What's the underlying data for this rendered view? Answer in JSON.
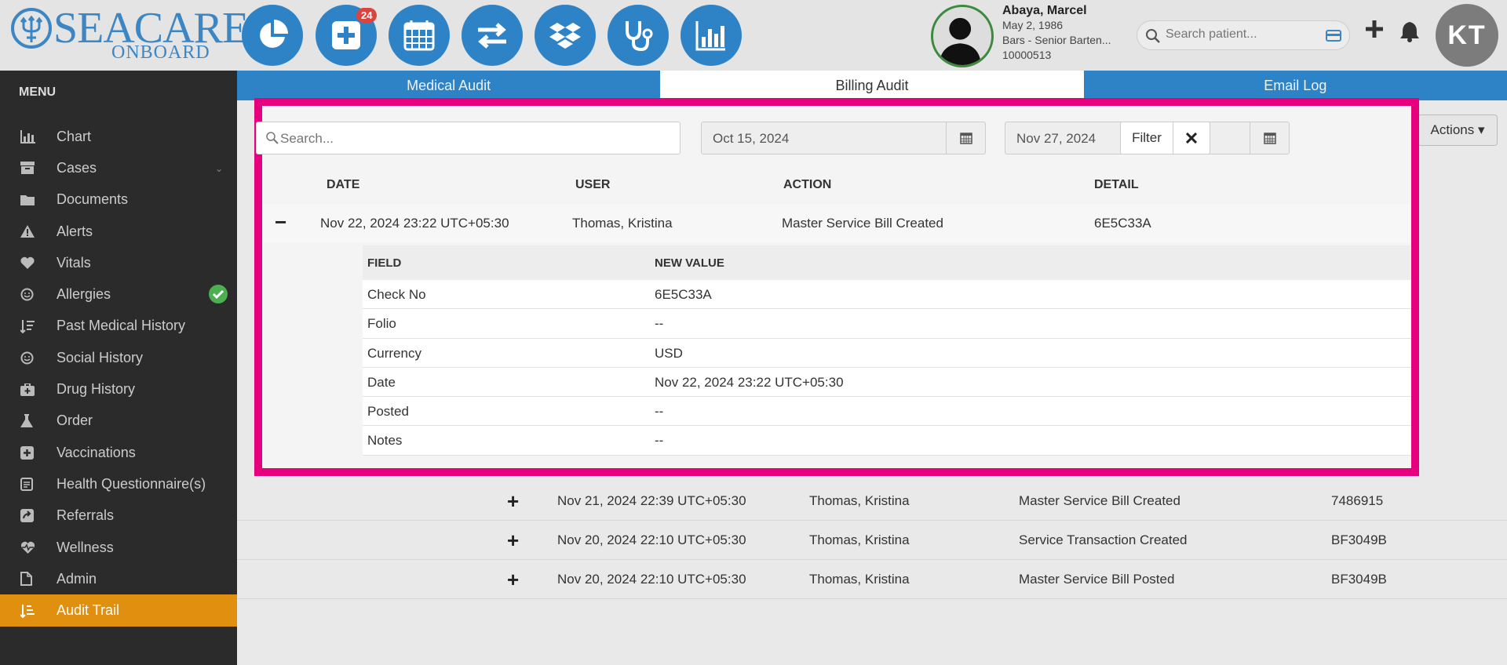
{
  "brand": {
    "name": "SEACARE",
    "sub": "ONBOARD"
  },
  "toolbar": {
    "buttons": [
      {
        "name": "dashboard-button",
        "icon": "pie-chart-icon"
      },
      {
        "name": "medical-cases-button",
        "icon": "medical-plus-icon",
        "badge": "24"
      },
      {
        "name": "calendar-button",
        "icon": "calendar-icon"
      },
      {
        "name": "transfer-button",
        "icon": "transfer-arrows-icon"
      },
      {
        "name": "dropbox-button",
        "icon": "dropbox-icon"
      },
      {
        "name": "stethoscope-button",
        "icon": "stethoscope-icon"
      },
      {
        "name": "reports-button",
        "icon": "bar-chart-icon"
      }
    ]
  },
  "patient": {
    "name": "Abaya, Marcel",
    "dob": "May 2, 1986",
    "role": "Bars - Senior Barten...",
    "id": "10000513"
  },
  "search": {
    "placeholder": "Search patient..."
  },
  "user": {
    "initials": "KT"
  },
  "sidebar": {
    "title": "MENU",
    "items": [
      {
        "label": "Chart",
        "icon": "bar-chart-icon"
      },
      {
        "label": "Cases",
        "icon": "archive-icon"
      },
      {
        "label": "Documents",
        "icon": "folder-icon"
      },
      {
        "label": "Alerts",
        "icon": "warning-icon"
      },
      {
        "label": "Vitals",
        "icon": "heart-icon"
      },
      {
        "label": "Allergies",
        "icon": "smile-icon"
      },
      {
        "label": "Past Medical History",
        "icon": "sort-icon"
      },
      {
        "label": "Social History",
        "icon": "smile-icon"
      },
      {
        "label": "Drug History",
        "icon": "medkit-icon"
      },
      {
        "label": "Order",
        "icon": "flask-icon"
      },
      {
        "label": "Vaccinations",
        "icon": "plus-square-icon"
      },
      {
        "label": "Health Questionnaire(s)",
        "icon": "questionnaire-icon"
      },
      {
        "label": "Referrals",
        "icon": "referral-icon"
      },
      {
        "label": "Wellness",
        "icon": "heartbeat-icon"
      },
      {
        "label": "Admin",
        "icon": "file-icon"
      },
      {
        "label": "Audit Trail",
        "icon": "audit-icon"
      }
    ],
    "active_color": "#e18f0f"
  },
  "tabs": [
    "Medical Audit",
    "Billing Audit",
    "Email Log"
  ],
  "actions_label": "Actions",
  "filter": {
    "search_placeholder": "Search...",
    "from_date": "Oct 15, 2024",
    "to_date": "Nov 27, 2024",
    "filter_label": "Filter"
  },
  "table": {
    "columns": [
      "DATE",
      "USER",
      "ACTION",
      "DETAIL"
    ],
    "expanded": {
      "date": "Nov 22, 2024 23:22 UTC+05:30",
      "user": "Thomas, Kristina",
      "action": "Master Service Bill Created",
      "detail": "6E5C33A",
      "sub_columns": [
        "FIELD",
        "NEW VALUE"
      ],
      "fields": [
        {
          "field": "Check No",
          "value": "6E5C33A"
        },
        {
          "field": "Folio",
          "value": "--"
        },
        {
          "field": "Currency",
          "value": "USD"
        },
        {
          "field": "Date",
          "value": "Nov 22, 2024 23:22 UTC+05:30"
        },
        {
          "field": "Posted",
          "value": "--"
        },
        {
          "field": "Notes",
          "value": "--"
        }
      ]
    },
    "rows": [
      {
        "date": "Nov 21, 2024 22:39 UTC+05:30",
        "user": "Thomas, Kristina",
        "action": "Master Service Bill Created",
        "detail": "7486915"
      },
      {
        "date": "Nov 20, 2024 22:10 UTC+05:30",
        "user": "Thomas, Kristina",
        "action": "Service Transaction Created",
        "detail": "BF3049B"
      },
      {
        "date": "Nov 20, 2024 22:10 UTC+05:30",
        "user": "Thomas, Kristina",
        "action": "Master Service Bill Posted",
        "detail": "BF3049B"
      }
    ]
  },
  "colors": {
    "primary": "#2e83c7",
    "highlight": "#e6007e",
    "sidebar": "#2b2b2b"
  }
}
